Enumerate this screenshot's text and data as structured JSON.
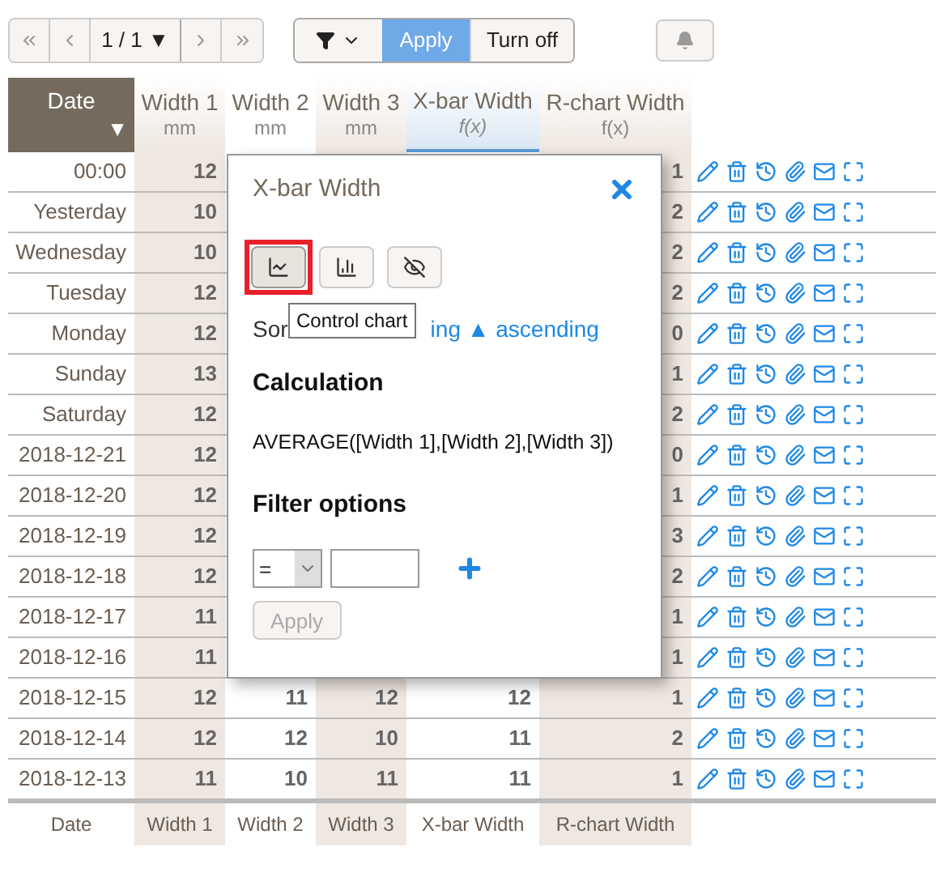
{
  "toolbar": {
    "page": "1 / 1",
    "page_caret": "▼",
    "filter_apply": "Apply",
    "filter_off": "Turn off"
  },
  "columns": [
    {
      "label": "Date",
      "sub": "▼",
      "kind": "sorted"
    },
    {
      "label": "Width 1",
      "sub": "mm",
      "kind": "plain"
    },
    {
      "label": "Width 2",
      "sub": "mm",
      "kind": "plain"
    },
    {
      "label": "Width 3",
      "sub": "mm",
      "kind": "plain"
    },
    {
      "label": "X-bar Width",
      "sub": "f(x)",
      "kind": "active"
    },
    {
      "label": "R-chart Width",
      "sub": "f(x)",
      "kind": "plain"
    }
  ],
  "rows": [
    {
      "date": "00:00",
      "width_1": "12",
      "r": "1"
    },
    {
      "date": "Yesterday",
      "width_1": "10",
      "r": "2"
    },
    {
      "date": "Wednesday",
      "width_1": "10",
      "r": "2"
    },
    {
      "date": "Tuesday",
      "width_1": "12",
      "r": "2"
    },
    {
      "date": "Monday",
      "width_1": "12",
      "r": "0"
    },
    {
      "date": "Sunday",
      "width_1": "13",
      "r": "1"
    },
    {
      "date": "Saturday",
      "width_1": "12",
      "r": "2"
    },
    {
      "date": "2018-12-21",
      "width_1": "12",
      "r": "0"
    },
    {
      "date": "2018-12-20",
      "width_1": "12",
      "r": "1"
    },
    {
      "date": "2018-12-19",
      "width_1": "12",
      "r": "3"
    },
    {
      "date": "2018-12-18",
      "width_1": "12",
      "r": "2"
    },
    {
      "date": "2018-12-17",
      "width_1": "11",
      "r": "1"
    },
    {
      "date": "2018-12-16",
      "width_1": "11",
      "r": "1"
    },
    {
      "date": "2018-12-15",
      "width_1": "12",
      "width_2": "11",
      "width_3": "12",
      "xbar": "12",
      "r": "1"
    },
    {
      "date": "2018-12-14",
      "width_1": "12",
      "width_2": "12",
      "width_3": "10",
      "xbar": "11",
      "r": "2"
    },
    {
      "date": "2018-12-13",
      "width_1": "11",
      "width_2": "10",
      "width_3": "11",
      "xbar": "11",
      "r": "1"
    }
  ],
  "footer": [
    "Date",
    "Width 1",
    "Width 2",
    "Width 3",
    "X-bar Width",
    "R-chart Width"
  ],
  "popup": {
    "title": "X-bar Width",
    "tooltip": "Control chart",
    "sort_label": "Sor",
    "sort_link": "ing ▲ ascending",
    "calc_heading": "Calculation",
    "formula": "AVERAGE([Width 1],[Width 2],[Width 3])",
    "filter_heading": "Filter options",
    "operator": "=",
    "apply": "Apply",
    "apply_disabled": true,
    "chart_buttons": [
      {
        "kind": "line",
        "highlighted": true
      },
      {
        "kind": "bar",
        "highlighted": false
      },
      {
        "kind": "hide",
        "highlighted": false
      }
    ]
  }
}
